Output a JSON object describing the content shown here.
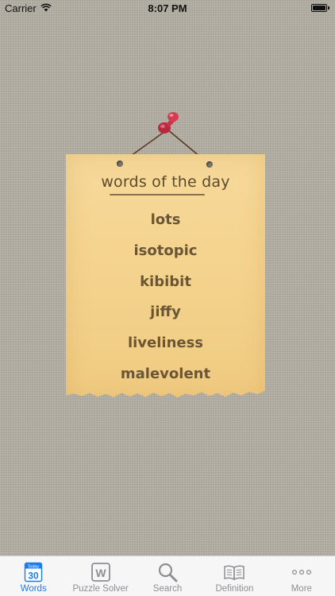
{
  "status_bar": {
    "carrier": "Carrier",
    "time": "8:07 PM"
  },
  "note": {
    "title": "words of the day",
    "words": [
      "lots",
      "isotopic",
      "kibibit",
      "jiffy",
      "liveliness",
      "malevolent"
    ]
  },
  "tab_bar": {
    "calendar_badge_top": "Today",
    "calendar_badge_day": "30",
    "puzzle_icon_letter": "W",
    "items": [
      {
        "label": "Words",
        "icon": "calendar-icon",
        "active": true
      },
      {
        "label": "Puzzle Solver",
        "icon": "puzzle-w-icon",
        "active": false
      },
      {
        "label": "Search",
        "icon": "search-icon",
        "active": false
      },
      {
        "label": "Definition",
        "icon": "book-icon",
        "active": false
      },
      {
        "label": "More",
        "icon": "more-dots-icon",
        "active": false
      }
    ]
  },
  "colors": {
    "accent": "#1b7cf2",
    "inactive": "#8e8e93",
    "note_paper": "#f4d28c",
    "note_ink": "#6a5534",
    "pin": "#c8354a"
  }
}
